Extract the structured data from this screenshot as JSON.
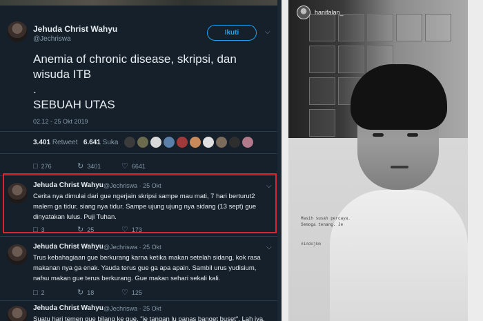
{
  "main_tweet": {
    "name": "Jehuda Christ Wahyu",
    "handle": "@Jechriswa",
    "follow_label": "Ikuti",
    "text_line1": "Anemia of chronic disease, skripsi, dan",
    "text_line2": "wisuda ITB",
    "text_dot": ".",
    "text_line3": "SEBUAH UTAS",
    "timestamp": "02.12 - 25 Okt 2019",
    "retweets_count": "3.401",
    "retweets_label": "Retweet",
    "likes_count": "6.641",
    "likes_label": "Suka",
    "actions": {
      "reply": "276",
      "retweet": "3401",
      "like": "6641"
    }
  },
  "replies": [
    {
      "name": "Jehuda Christ Wahyu",
      "handle_time": "@Jechriswa · 25 Okt",
      "text": "Cerita nya dimulai dari gue ngerjain skripsi sampe mau mati, 7 hari berturut2 malem ga tidur, siang nya tidur. Sampe ujung ujung nya sidang (13 sept) gue dinyatakan lulus. Puji Tuhan.",
      "actions": {
        "reply": "3",
        "retweet": "25",
        "like": "173"
      }
    },
    {
      "name": "Jehuda Christ Wahyu",
      "handle_time": "@Jechriswa · 25 Okt",
      "text": "Trus kebahagiaan gue berkurang karna ketika makan setelah sidang, kok rasa makanan nya ga enak. Yauda terus gue ga apa apain. Sambil urus yudisium, nafsu makan gue terus berkurang. Gue makan sehari sekali kali.",
      "actions": {
        "reply": "2",
        "retweet": "18",
        "like": "125"
      }
    },
    {
      "name": "Jehuda Christ Wahyu",
      "handle_time": "@Jechriswa · 25 Okt",
      "text": "Suatu hari temen gue bilang ke gue, \"je tangan lu panas banget buset\". Lah iya,"
    }
  ],
  "story": {
    "username": "hanifalan_",
    "caption_line1": "Masih susah percaya.",
    "caption_line2": "Semoga tenang. Je",
    "hashtag": "#indojkm"
  },
  "colors": {
    "background": "#15202b",
    "accent": "#1da1f2",
    "highlight": "#d9262c"
  }
}
